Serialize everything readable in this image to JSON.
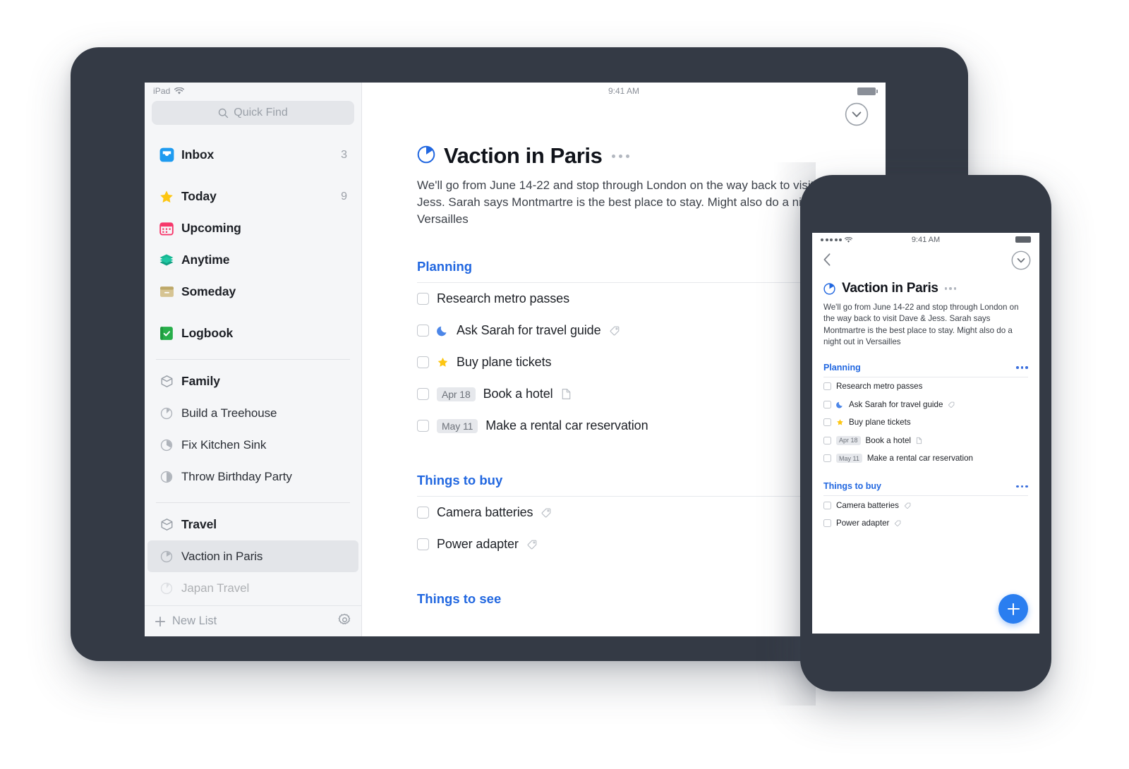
{
  "ipad": {
    "status_bar": {
      "device_label": "iPad",
      "wifi_icon": "wifi-icon",
      "time": "9:41 AM",
      "battery_icon": "battery-icon"
    },
    "search": {
      "placeholder": "Quick Find",
      "icon": "search-icon"
    },
    "nav_items": [
      {
        "label": "Inbox",
        "count": "3",
        "icon": "inbox-icon",
        "color": "#1e9bf0"
      },
      {
        "label": "Today",
        "count": "9",
        "icon": "star-icon",
        "color": "#fdc612"
      },
      {
        "label": "Upcoming",
        "count": "",
        "icon": "calendar-icon",
        "color": "#f6376b"
      },
      {
        "label": "Anytime",
        "count": "",
        "icon": "layers-icon",
        "color": "#16b893"
      },
      {
        "label": "Someday",
        "count": "",
        "icon": "box-icon",
        "color": "#c3ab63"
      },
      {
        "label": "Logbook",
        "count": "",
        "icon": "book-check-icon",
        "color": "#27ae4a"
      }
    ],
    "areas": [
      {
        "name": "Family",
        "icon": "area-cube-icon",
        "projects": [
          {
            "label": "Build a Treehouse",
            "icon": "progress-pie-icon",
            "progress": 12
          },
          {
            "label": "Fix Kitchen Sink",
            "icon": "progress-pie-icon",
            "progress": 28
          },
          {
            "label": "Throw Birthday Party",
            "icon": "progress-pie-icon",
            "progress": 50
          }
        ]
      },
      {
        "name": "Travel",
        "icon": "area-cube-icon",
        "projects": [
          {
            "label": "Vaction in Paris",
            "icon": "progress-pie-icon",
            "progress": 18,
            "selected": true
          },
          {
            "label": "Japan Travel",
            "icon": "progress-pie-icon",
            "progress": 10,
            "cut_off": true
          }
        ]
      }
    ],
    "footer": {
      "new_list_label": "New List",
      "new_list_icon": "plus-icon",
      "settings_icon": "gear-icon"
    },
    "collapse_button_icon": "chevron-down-circle-icon",
    "project": {
      "title": "Vaction in Paris",
      "icon": "progress-pie-icon",
      "menu_icon": "ellipsis-icon",
      "notes": "We'll go from June 14-22 and stop through London on the way back to visit Dave & Jess. Sarah says Montmartre is the best place to stay. Might also do a night out in Versailles",
      "sections": [
        {
          "heading": "Planning",
          "tasks": [
            {
              "title": "Research metro passes",
              "badge": "",
              "marker": "",
              "trailing": ""
            },
            {
              "title": "Ask Sarah for travel guide",
              "badge": "",
              "marker": "moon-icon",
              "trailing": "tag-icon"
            },
            {
              "title": "Buy plane tickets",
              "badge": "",
              "marker": "star-icon",
              "trailing": ""
            },
            {
              "title": "Book a hotel",
              "badge": "Apr 18",
              "marker": "",
              "trailing": "note-icon"
            },
            {
              "title": "Make a rental car reservation",
              "badge": "May 11",
              "marker": "",
              "trailing": ""
            }
          ]
        },
        {
          "heading": "Things to buy",
          "tasks": [
            {
              "title": "Camera batteries",
              "badge": "",
              "marker": "",
              "trailing": "tag-icon"
            },
            {
              "title": "Power adapter",
              "badge": "",
              "marker": "",
              "trailing": "tag-icon"
            }
          ]
        },
        {
          "heading": "Things to see",
          "tasks": []
        }
      ]
    }
  },
  "iphone": {
    "status_bar": {
      "signal_icon": "signal-dots-icon",
      "wifi_icon": "wifi-icon",
      "time": "9:41 AM",
      "battery_icon": "battery-icon"
    },
    "nav": {
      "back_icon": "chevron-left-icon",
      "collapse_icon": "chevron-down-circle-icon"
    },
    "project": {
      "title": "Vaction in Paris",
      "icon": "progress-pie-icon",
      "menu_icon": "ellipsis-icon",
      "notes": "We'll go from June 14-22 and stop through London on the way back to visit Dave & Jess. Sarah says Montmartre is the best place to stay. Might also do a night out in Versailles",
      "sections": [
        {
          "heading": "Planning",
          "menu_icon": "ellipsis-icon",
          "tasks": [
            {
              "title": "Research metro passes",
              "badge": "",
              "marker": "",
              "trailing": ""
            },
            {
              "title": "Ask Sarah for travel guide",
              "badge": "",
              "marker": "moon-icon",
              "trailing": "tag-icon"
            },
            {
              "title": "Buy plane tickets",
              "badge": "",
              "marker": "star-icon",
              "trailing": ""
            },
            {
              "title": "Book a hotel",
              "badge": "Apr 18",
              "marker": "",
              "trailing": "note-icon"
            },
            {
              "title": "Make a rental car reservation",
              "badge": "May 11",
              "marker": "",
              "trailing": ""
            }
          ]
        },
        {
          "heading": "Things to buy",
          "menu_icon": "ellipsis-icon",
          "tasks": [
            {
              "title": "Camera batteries",
              "badge": "",
              "marker": "",
              "trailing": "tag-icon"
            },
            {
              "title": "Power adapter",
              "badge": "",
              "marker": "",
              "trailing": "tag-icon"
            }
          ]
        }
      ]
    },
    "fab": {
      "icon": "plus-icon",
      "color": "#2a7ef0"
    }
  },
  "theme": {
    "accent_blue": "#2167e0",
    "device_bezel": "#343a45",
    "sidebar_bg": "#f5f6f8",
    "selection_bg": "#e3e5e9"
  }
}
